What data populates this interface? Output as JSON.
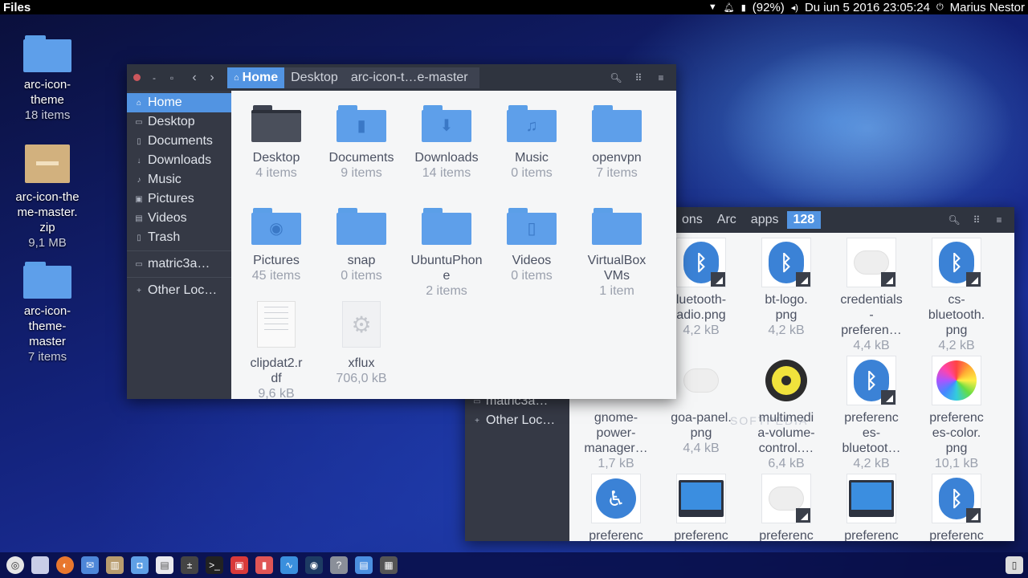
{
  "top_panel": {
    "app_name": "Files",
    "battery": "(92%)",
    "datetime": "Du iun  5 2016 23:05:24",
    "user": "Marius Nestor"
  },
  "desktop": [
    {
      "name": "arc-icon-theme",
      "sub": "18 items",
      "type": "folder"
    },
    {
      "name": "arc-icon-theme-master.zip",
      "sub": "9,1 MB",
      "type": "zip"
    },
    {
      "name": "arc-icon-theme-master",
      "sub": "7 items",
      "type": "folder"
    }
  ],
  "window1": {
    "breadcrumbs": [
      "Home",
      "Desktop",
      "arc-icon-t…e-master"
    ],
    "sidebar": [
      "Home",
      "Desktop",
      "Documents",
      "Downloads",
      "Music",
      "Pictures",
      "Videos",
      "Trash",
      "matric3a…",
      "Other Loc…"
    ],
    "items": [
      {
        "name": "Desktop",
        "sub": "4 items"
      },
      {
        "name": "Documents",
        "sub": "9 items"
      },
      {
        "name": "Downloads",
        "sub": "14 items"
      },
      {
        "name": "Music",
        "sub": "0 items"
      },
      {
        "name": "openvpn",
        "sub": "7 items"
      },
      {
        "name": "Pictures",
        "sub": "45 items"
      },
      {
        "name": "snap",
        "sub": "0 items"
      },
      {
        "name": "UbuntuPhone",
        "sub": "2 items"
      },
      {
        "name": "Videos",
        "sub": "0 items"
      },
      {
        "name": "VirtualBox VMs",
        "sub": "1 item"
      },
      {
        "name": "clipdat2.rdf",
        "sub": "9,6 kB"
      },
      {
        "name": "xflux",
        "sub": "706,0 kB"
      }
    ]
  },
  "window2": {
    "breadcrumbs": [
      "ons",
      "Arc",
      "apps",
      "128"
    ],
    "sidebar": [
      "matric3a…",
      "Other Loc…"
    ],
    "items": [
      {
        "name": "bluetooth-radio.png",
        "label1": "luetooth-",
        "label2": "adio.png",
        "sub": "4,2 kB"
      },
      {
        "name": "bt-logo.png",
        "label1": "bt-logo.",
        "label2": "png",
        "sub": "4,2 kB"
      },
      {
        "name": "credentials-preferences",
        "label1": "credentials",
        "label2": "-",
        "label3": "preferen…",
        "sub": "4,4 kB"
      },
      {
        "name": "cs-bluetooth.png",
        "label1": "cs-",
        "label2": "bluetooth.",
        "label3": "png",
        "sub": "4,2 kB"
      },
      {
        "name": "gnome-power-manager",
        "label1": "gnome-",
        "label2": "power-",
        "label3": "manager…",
        "sub": "1,7 kB"
      },
      {
        "name": "goa-panel.png",
        "label1": "goa-panel.",
        "label2": "png",
        "sub": "4,4 kB"
      },
      {
        "name": "multimedia-volume-control",
        "label1": "multimedi",
        "label2": "a-volume-",
        "label3": "control.…",
        "sub": "6,4 kB"
      },
      {
        "name": "preferences-bluetooth",
        "label1": "preferenc",
        "label2": "es-",
        "label3": "bluetoot…",
        "sub": "4,2 kB"
      },
      {
        "name": "preferences-color.png",
        "label1": "preferenc",
        "label2": "es-color.",
        "label3": "png",
        "sub": "10,1 kB"
      },
      {
        "label1": "preferenc"
      },
      {
        "label1": "preferenc"
      },
      {
        "label1": "preferenc"
      },
      {
        "label1": "preferenc"
      },
      {
        "label1": "preferenc"
      }
    ],
    "watermark": "SOFTPEDIA"
  }
}
